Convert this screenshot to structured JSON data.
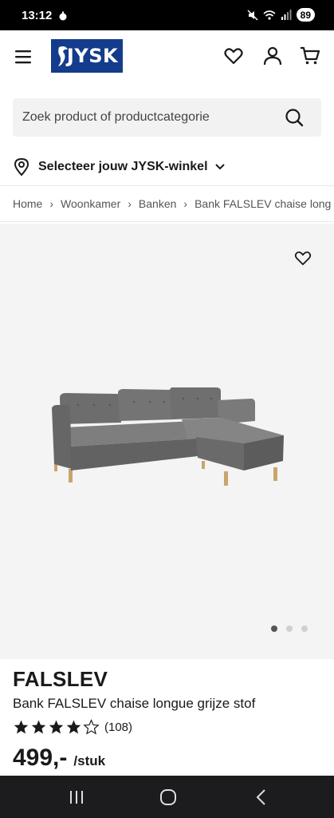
{
  "status_bar": {
    "time": "13:12",
    "battery": "89"
  },
  "header": {
    "logo_text": "JYSK"
  },
  "search": {
    "placeholder": "Zoek product of productcategorie"
  },
  "store_selector": {
    "label": "Selecteer jouw JYSK-winkel"
  },
  "breadcrumb": [
    "Home",
    "Woonkamer",
    "Banken",
    "Bank FALSLEV chaise long"
  ],
  "gallery": {
    "image_count": 3,
    "active_index": 0
  },
  "product": {
    "name": "FALSLEV",
    "description": "Bank FALSLEV chaise longue grijze stof",
    "rating_stars": 4,
    "rating_max": 5,
    "rating_count": "(108)",
    "price": "499,-",
    "price_unit": "/stuk"
  },
  "colors": {
    "brand": "#143c8c",
    "status_bar": "#000000",
    "nav_bar": "#1c1c1e",
    "gallery_bg": "#f4f4f4"
  }
}
